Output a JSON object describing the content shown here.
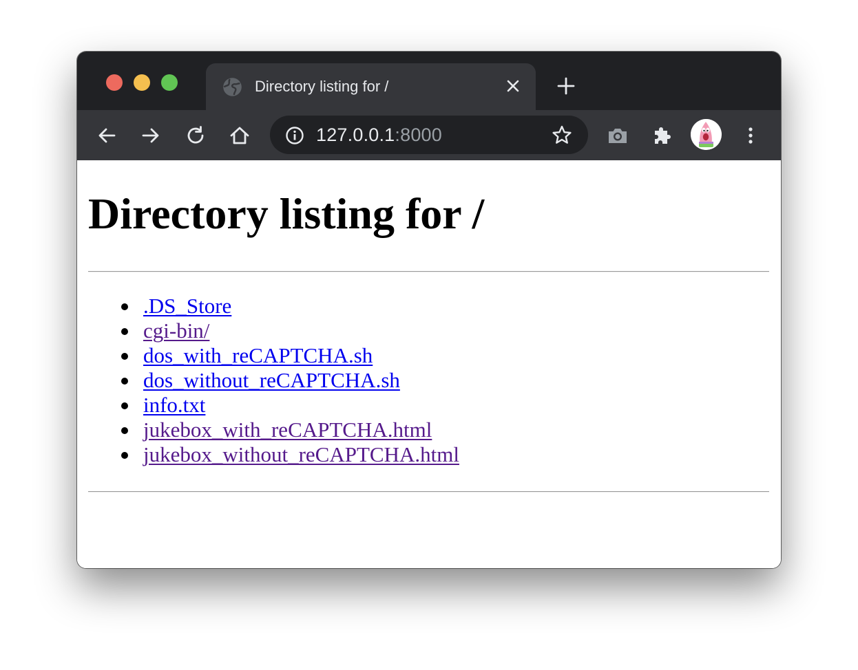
{
  "browser": {
    "tab": {
      "title": "Directory listing for /"
    },
    "address_bar": {
      "host": "127.0.0.1",
      "port": ":8000"
    }
  },
  "page": {
    "heading": "Directory listing for /",
    "entries": [
      {
        "label": ".DS_Store",
        "visited": false
      },
      {
        "label": "cgi-bin/",
        "visited": true
      },
      {
        "label": "dos_with_reCAPTCHA.sh",
        "visited": false
      },
      {
        "label": "dos_without_reCAPTCHA.sh",
        "visited": false
      },
      {
        "label": "info.txt",
        "visited": false
      },
      {
        "label": "jukebox_with_reCAPTCHA.html",
        "visited": true
      },
      {
        "label": "jukebox_without_reCAPTCHA.html",
        "visited": true
      }
    ]
  },
  "colors": {
    "tabstrip_bg": "#202124",
    "toolbar_bg": "#35363a",
    "link_unvisited": "#0000ee",
    "link_visited": "#551a8b"
  },
  "icons": {
    "tab": [
      "globe-icon",
      "close-icon"
    ],
    "tabstrip": [
      "new-tab-icon"
    ],
    "toolbar": [
      "back-arrow-icon",
      "forward-arrow-icon",
      "reload-icon",
      "home-icon",
      "info-icon",
      "star-icon",
      "camera-icon",
      "puzzle-icon",
      "avatar",
      "kebab-menu-icon"
    ]
  }
}
